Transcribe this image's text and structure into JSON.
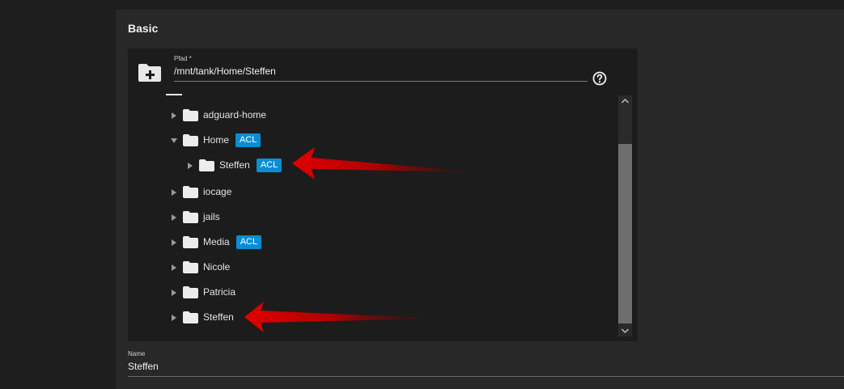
{
  "section": {
    "title": "Basic"
  },
  "explorer": {
    "path_label": "Pfad *",
    "path_value": "/mnt/tank/Home/Steffen",
    "items": [
      {
        "label": "adguard-home",
        "expanded": false,
        "acl": ""
      },
      {
        "label": "Home",
        "expanded": true,
        "acl": "ACL"
      },
      {
        "label": "Steffen",
        "expanded": false,
        "acl": "ACL"
      },
      {
        "label": "iocage",
        "expanded": false,
        "acl": ""
      },
      {
        "label": "jails",
        "expanded": false,
        "acl": ""
      },
      {
        "label": "Media",
        "expanded": false,
        "acl": "ACL"
      },
      {
        "label": "Nicole",
        "expanded": false,
        "acl": ""
      },
      {
        "label": "Patricia",
        "expanded": false,
        "acl": ""
      },
      {
        "label": "Steffen",
        "expanded": false,
        "acl": ""
      }
    ]
  },
  "name_field": {
    "label": "Name",
    "value": "Steffen"
  },
  "colors": {
    "acl_badge": "#0b8ed1",
    "annotation_arrow": "#e00000"
  },
  "icons": {
    "new_folder": "folder-plus-icon",
    "help": "help-circle-icon",
    "collapsed": "triangle-right-icon",
    "expanded": "triangle-down-icon",
    "folder": "folder-icon"
  }
}
